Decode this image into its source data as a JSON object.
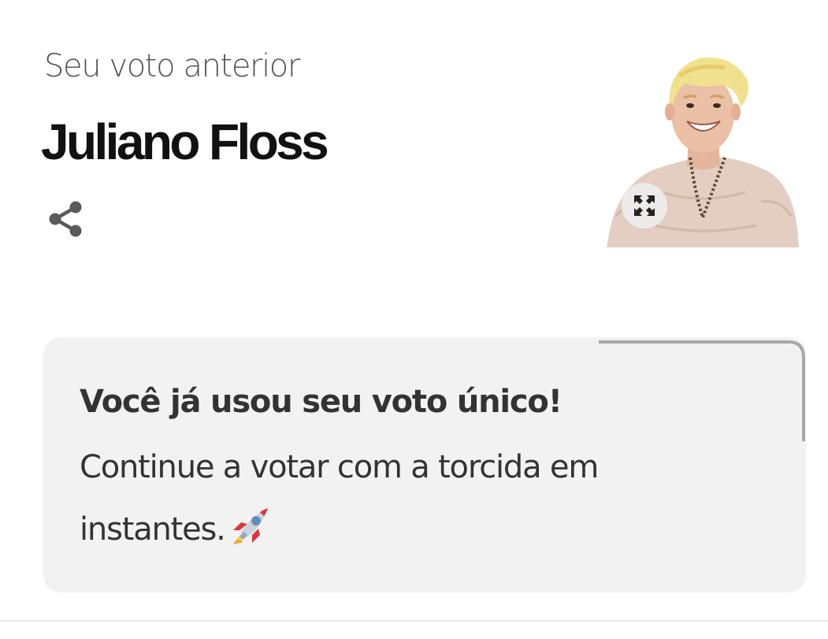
{
  "vote": {
    "previous_label": "Seu voto anterior",
    "candidate_name": "Juliano Floss"
  },
  "icons": {
    "share": "share-icon",
    "expand": "expand-icon",
    "rocket": "rocket-icon"
  },
  "notice": {
    "title": "Você já usou seu voto único!",
    "body": "Continue a votar com a torcida em instantes."
  },
  "colors": {
    "card_background": "#f2f2f2",
    "text_dark": "#333333",
    "name_text": "#111111",
    "progress_border": "#a8a8a8"
  }
}
